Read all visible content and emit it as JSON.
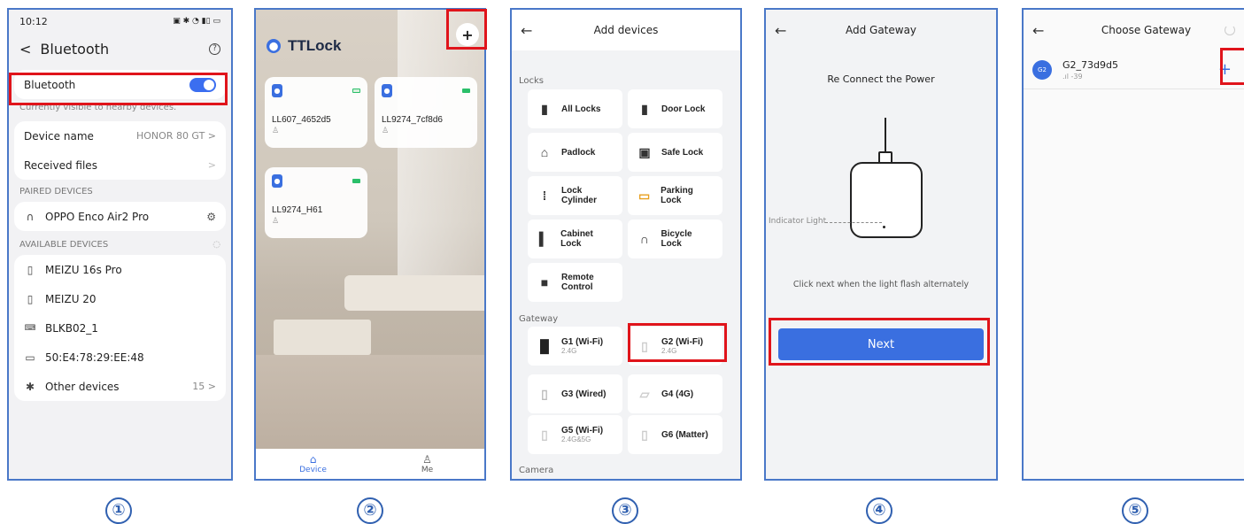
{
  "steps": [
    "①",
    "②",
    "③",
    "④",
    "⑤"
  ],
  "screen1": {
    "time": "10:12",
    "status_icons": "▣ ✱ ◔ ▮▯ ▭",
    "back": "<",
    "title": "Bluetooth",
    "help": "?",
    "bt_label": "Bluetooth",
    "bt_sub": "Currently visible to nearby devices.",
    "device_name_label": "Device name",
    "device_name_value": "HONOR 80 GT >",
    "received_files": "Received files",
    "chev": ">",
    "paired_header": "PAIRED DEVICES",
    "paired": [
      {
        "name": "OPPO Enco Air2 Pro",
        "icon": "headphones-icon"
      }
    ],
    "available_header": "AVAILABLE DEVICES",
    "available": [
      {
        "name": "MEIZU 16s Pro",
        "icon": "phone-icon"
      },
      {
        "name": "MEIZU 20",
        "icon": "phone-icon"
      },
      {
        "name": "BLKB02_1",
        "icon": "keyboard-icon"
      },
      {
        "name": "50:E4:78:29:EE:48",
        "icon": "laptop-icon"
      }
    ],
    "other_label": "Other devices",
    "other_count": "15 >"
  },
  "screen2": {
    "app_name": "TTLock",
    "plus": "+",
    "locks": [
      {
        "name": "LL607_4652d5"
      },
      {
        "name": "LL9274_7cf8d6"
      },
      {
        "name": "LL9274_H61"
      }
    ],
    "tabs": {
      "device": "Device",
      "me": "Me"
    }
  },
  "screen3": {
    "back": "←",
    "title": "Add devices",
    "locks_header": "Locks",
    "locks": [
      "All Locks",
      "Door Lock",
      "Padlock",
      "Safe Lock",
      "Lock Cylinder",
      "Parking Lock",
      "Cabinet Lock",
      "Bicycle Lock",
      "Remote Control"
    ],
    "gateway_header": "Gateway",
    "gateways": [
      {
        "name": "G1 (Wi-Fi)",
        "band": "2.4G"
      },
      {
        "name": "G2 (Wi-Fi)",
        "band": "2.4G"
      },
      {
        "name": "G3 (Wired)",
        "band": ""
      },
      {
        "name": "G4 (4G)",
        "band": ""
      },
      {
        "name": "G5 (Wi-Fi)",
        "band": "2.4G&5G"
      },
      {
        "name": "G6 (Matter)",
        "band": ""
      }
    ],
    "camera_header": "Camera"
  },
  "screen4": {
    "back": "←",
    "title": "Add Gateway",
    "instruction": "Re Connect the Power",
    "indicator": "Indicator Light",
    "note": "Click next when the light flash alternately",
    "next": "Next"
  },
  "screen5": {
    "back": "←",
    "title": "Choose Gateway",
    "gateway_name": "G2_73d9d5",
    "avatar": "G2",
    "signal": ".ıl -39",
    "add": "+"
  },
  "colors": {
    "accent": "#3a6fe0",
    "highlight": "#e0141b",
    "frame": "#4a78c8"
  }
}
